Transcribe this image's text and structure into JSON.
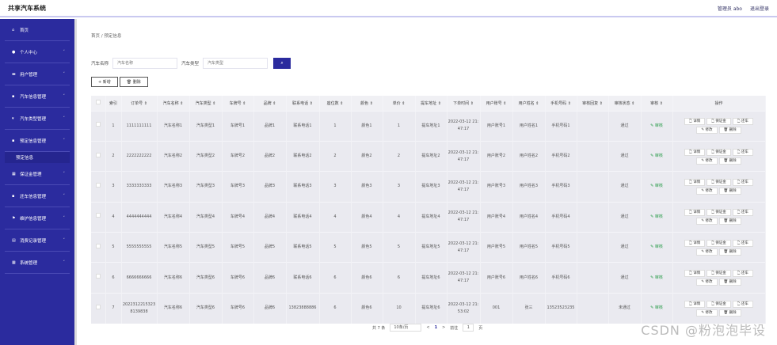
{
  "header": {
    "title": "共享汽车系统",
    "user": "管理员 abo",
    "logout": "退出登录"
  },
  "sidebar": {
    "items": [
      {
        "label": "首页",
        "icon": "home-icon",
        "chev": false
      },
      {
        "label": "个人中心",
        "icon": "user-icon",
        "chev": true
      },
      {
        "label": "用户管理",
        "icon": "monitor-icon",
        "chev": true
      },
      {
        "label": "汽车信息管理",
        "icon": "clipboard-icon",
        "chev": true
      },
      {
        "label": "汽车类型管理",
        "icon": "cup-icon",
        "chev": true
      },
      {
        "label": "预定信息管理",
        "icon": "briefcase-icon",
        "chev": true,
        "sub": "预定信息"
      },
      {
        "label": "保证金管理",
        "icon": "grid-icon",
        "chev": true
      },
      {
        "label": "还车信息管理",
        "icon": "clipboard-icon",
        "chev": true
      },
      {
        "label": "维护信息管理",
        "icon": "flag-icon",
        "chev": true
      },
      {
        "label": "消费记录管理",
        "icon": "list-icon",
        "chev": true
      },
      {
        "label": "系统管理",
        "icon": "grid-icon",
        "chev": true
      }
    ]
  },
  "breadcrumb": {
    "home": "首页",
    "sep": "/",
    "current": "预定信息"
  },
  "search": {
    "car_name_label": "汽车名称",
    "car_name_placeholder": "汽车名称",
    "car_type_label": "汽车类型",
    "car_type_placeholder": "汽车类型",
    "search_icon": "⌕"
  },
  "toolbar": {
    "add": "+ 新增",
    "delete": "🗑 删除"
  },
  "table": {
    "headers": [
      "",
      "索引",
      "订单号 ⇕",
      "汽车名称 ⇕",
      "汽车类型 ⇕",
      "车牌号 ⇕",
      "品牌 ⇕",
      "联系电话 ⇕",
      "座位数 ⇕",
      "颜色 ⇕",
      "单价 ⇕",
      "提车地址 ⇕",
      "下单时间 ⇕",
      "用户账号 ⇕",
      "用户姓名 ⇕",
      "手机号码 ⇕",
      "审核回复 ⇕",
      "审核状态 ⇕",
      "审核 ⇕",
      "操作"
    ],
    "rows": [
      [
        "1",
        "1111111111",
        "汽车名称1",
        "汽车类型1",
        "车牌号1",
        "品牌1",
        "联系电话1",
        "1",
        "颜色1",
        "1",
        "提车地址1",
        "2022-03-12 21:47:17",
        "用户账号1",
        "用户姓名1",
        "手机号码1",
        "",
        "通过"
      ],
      [
        "2",
        "2222222222",
        "汽车名称2",
        "汽车类型2",
        "车牌号2",
        "品牌2",
        "联系电话2",
        "2",
        "颜色2",
        "2",
        "提车地址2",
        "2022-03-12 21:47:17",
        "用户账号2",
        "用户姓名2",
        "手机号码2",
        "",
        "通过"
      ],
      [
        "3",
        "3333333333",
        "汽车名称3",
        "汽车类型3",
        "车牌号3",
        "品牌3",
        "联系电话3",
        "3",
        "颜色3",
        "3",
        "提车地址3",
        "2022-03-12 21:47:17",
        "用户账号3",
        "用户姓名3",
        "手机号码3",
        "",
        "通过"
      ],
      [
        "4",
        "4444444444",
        "汽车名称4",
        "汽车类型4",
        "车牌号4",
        "品牌4",
        "联系电话4",
        "4",
        "颜色4",
        "4",
        "提车地址4",
        "2022-03-12 21:47:17",
        "用户账号4",
        "用户姓名4",
        "手机号码4",
        "",
        "通过"
      ],
      [
        "5",
        "5555555555",
        "汽车名称5",
        "汽车类型5",
        "车牌号5",
        "品牌5",
        "联系电话5",
        "5",
        "颜色5",
        "5",
        "提车地址5",
        "2022-03-12 21:47:17",
        "用户账号5",
        "用户姓名5",
        "手机号码5",
        "",
        "通过"
      ],
      [
        "6",
        "6666666666",
        "汽车名称6",
        "汽车类型6",
        "车牌号6",
        "品牌6",
        "联系电话6",
        "6",
        "颜色6",
        "6",
        "提车地址6",
        "2022-03-12 21:47:17",
        "用户账号6",
        "用户姓名6",
        "手机号码6",
        "",
        "通过"
      ],
      [
        "7",
        "20223122153238139838",
        "汽车名称6",
        "汽车类型6",
        "车牌号6",
        "品牌6",
        "13823888886",
        "6",
        "颜色6",
        "10",
        "提车地址6",
        "2022-03-12 21:53:02",
        "001",
        "张三",
        "13523523235",
        "",
        "未通过"
      ]
    ],
    "review_label": "✎ 审核",
    "actions": [
      "🗋 详情",
      "🗋 保证金",
      "🗋 还车",
      "✎ 修改",
      "🗑 删除"
    ]
  },
  "pagination": {
    "total": "共 7 条",
    "page_size": "10条/页",
    "prev": "<",
    "current": "1",
    "next": ">",
    "goto": "前往",
    "goto_value": "1",
    "page_unit": "页"
  },
  "watermark": "CSDN @粉泡泡毕设"
}
